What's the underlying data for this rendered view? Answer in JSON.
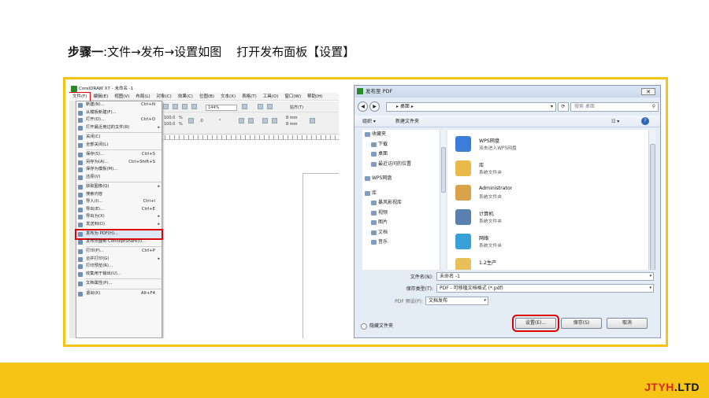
{
  "heading": {
    "step": "步骤一",
    "text": ":文件→发布→设置如图    打开发布面板【设置】"
  },
  "brand": {
    "part1": "JTYH",
    "part2": ".LTD"
  },
  "colors": {
    "accent": "#f6c415",
    "highlight": "#d00000"
  },
  "coreldraw": {
    "title": "CorelDRAW X7 - 未命名 -1",
    "menubar": [
      "文件(F)",
      "编辑(E)",
      "视图(V)",
      "布局(L)",
      "对象(C)",
      "效果(C)",
      "位图(B)",
      "文本(X)",
      "表格(T)",
      "工具(O)",
      "窗口(W)",
      "帮助(H)"
    ],
    "toolbar": {
      "zoom": "144%",
      "snap": "贴齐(T)",
      "w": "100.0",
      "h": "100.0",
      "pct": "%",
      "angle": ".0",
      "deg": "°",
      "mm1": "8 mm",
      "mm2": "8 mm"
    },
    "menu_items": [
      {
        "label": "新建(N)...",
        "shortcut": "Ctrl+N"
      },
      {
        "label": "从模板新建(F)...",
        "shortcut": ""
      },
      {
        "label": "打开(O)...",
        "shortcut": "Ctrl+O"
      },
      {
        "label": "打开最近用过的文件(R)",
        "shortcut": "",
        "arrow": true
      },
      {
        "sep": true
      },
      {
        "label": "关闭(C)",
        "shortcut": ""
      },
      {
        "label": "全部关闭(L)",
        "shortcut": ""
      },
      {
        "sep": true
      },
      {
        "label": "保存(S)...",
        "shortcut": "Ctrl+S"
      },
      {
        "label": "另存为(A)...",
        "shortcut": "Ctrl+Shift+S"
      },
      {
        "label": "保存为模板(M)...",
        "shortcut": ""
      },
      {
        "label": "还原(V)",
        "shortcut": ""
      },
      {
        "sep": true
      },
      {
        "label": "获取图像(Q)",
        "shortcut": "",
        "arrow": true
      },
      {
        "label": "搜索内容",
        "shortcut": ""
      },
      {
        "label": "导入(I)...",
        "shortcut": "Ctrl+I"
      },
      {
        "label": "导出(E)...",
        "shortcut": "Ctrl+E"
      },
      {
        "label": "导出为(X)",
        "shortcut": "",
        "arrow": true
      },
      {
        "label": "发送到(D)",
        "shortcut": "",
        "arrow": true
      },
      {
        "sep": true
      },
      {
        "label": "发布为 PDF(H)...",
        "shortcut": "",
        "selected": true
      },
      {
        "label": "发布页面到 ConceptShare(I)...",
        "shortcut": ""
      },
      {
        "sep": true
      },
      {
        "label": "打印(P)...",
        "shortcut": "Ctrl+P"
      },
      {
        "label": "合并打印(G)",
        "shortcut": "",
        "arrow": true
      },
      {
        "label": "打印预览(R)...",
        "shortcut": ""
      },
      {
        "label": "收集用于输出(U)...",
        "shortcut": ""
      },
      {
        "sep": true
      },
      {
        "label": "文档属性(P)...",
        "shortcut": ""
      },
      {
        "sep": true
      },
      {
        "label": "退出(X)",
        "shortcut": "Alt+F4"
      }
    ]
  },
  "dialog": {
    "title": "发布至 PDF",
    "close": "✕",
    "path": "▸ 桌面 ▸",
    "search_placeholder": "搜索 桌面",
    "organize": "组织 ▾",
    "new_folder": "新建文件夹",
    "nav": [
      {
        "label": "收藏夹",
        "sub": false
      },
      {
        "label": "下载",
        "sub": true
      },
      {
        "label": "桌面",
        "sub": true
      },
      {
        "label": "最近访问的位置",
        "sub": true
      },
      {
        "label": "WPS网盘",
        "sub": false,
        "gap": true
      },
      {
        "label": "库",
        "sub": false,
        "gap": true
      },
      {
        "label": "暴风影视库",
        "sub": true
      },
      {
        "label": "视频",
        "sub": true
      },
      {
        "label": "图片",
        "sub": true
      },
      {
        "label": "文档",
        "sub": true
      },
      {
        "label": "音乐",
        "sub": true
      }
    ],
    "files": [
      {
        "name": "WPS网盘",
        "desc": "双击进入WPS网盘",
        "icon": "cloud-icon",
        "color": "#3b7dd8"
      },
      {
        "name": "库",
        "desc": "系统文件夹",
        "icon": "library-icon",
        "color": "#e9b949"
      },
      {
        "name": "Administrator",
        "desc": "系统文件夹",
        "icon": "user-folder-icon",
        "color": "#d9a34a"
      },
      {
        "name": "计算机",
        "desc": "系统文件夹",
        "icon": "computer-icon",
        "color": "#5a7fb0"
      },
      {
        "name": "网络",
        "desc": "系统文件夹",
        "icon": "network-icon",
        "color": "#3aa0d8"
      },
      {
        "name": "1.2生产",
        "desc": "",
        "icon": "folder-icon",
        "color": "#e8c05a"
      }
    ],
    "filename_label": "文件名(N):",
    "filename_value": "未命名 -1",
    "filetype_label": "保存类型(T):",
    "filetype_value": "PDF - 可移植文档格式 (*.pdf)",
    "preset_label": "PDF 预设(P):",
    "preset_value": "文档发布",
    "settings_button": "设置(E)...",
    "save_button": "保存(S)",
    "cancel_button": "取消",
    "hide_folders": "隐藏文件夹"
  }
}
